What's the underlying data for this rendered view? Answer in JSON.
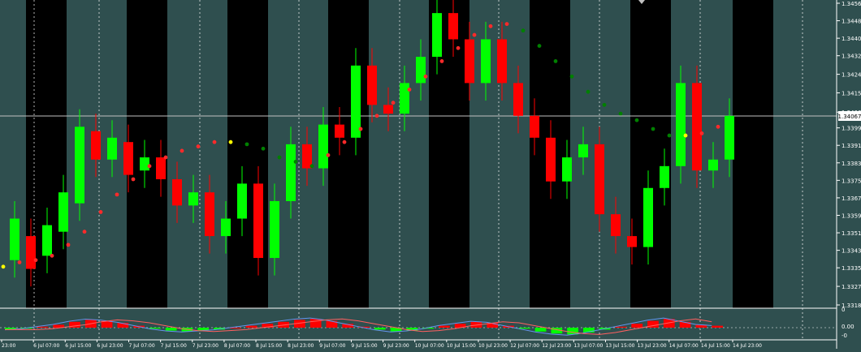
{
  "colors": {
    "background": "#2f4f4f",
    "session_band": "#000000",
    "bull_candle": "#00ff00",
    "bear_candle": "#ff0000",
    "ma_up": "#ff2a2a",
    "ma_flat": "#ffff00",
    "ma_down": "#008000",
    "axis_text": "#ffffff",
    "grid": "#ffffff"
  },
  "price_axis": {
    "labels": [
      "1.34565",
      "1.34485",
      "1.34405",
      "1.34325",
      "1.34240",
      "1.34155",
      "1.34067",
      "1.33995",
      "1.33915",
      "1.33835",
      "1.33755",
      "1.33675",
      "1.33595",
      "1.33515",
      "1.33435",
      "1.33355",
      "1.33270",
      "1.33185"
    ],
    "current_price": "1.34067"
  },
  "oscillator_axis": {
    "labels": [
      "0",
      "0.00",
      "-0"
    ]
  },
  "time_axis": {
    "labels": [
      "23:00",
      "6 Jul 07:00",
      "6 Jul 15:00",
      "6 Jul 23:00",
      "7 Jul 07:00",
      "7 Jul 15:00",
      "7 Jul 23:00",
      "8 Jul 07:00",
      "8 Jul 15:00",
      "8 Jul 23:00",
      "9 Jul 07:00",
      "9 Jul 15:00",
      "9 Jul 23:00",
      "10 Jul 07:00",
      "10 Jul 15:00",
      "10 Jul 23:00",
      "12 Jul 07:00",
      "12 Jul 23:00",
      "13 Jul 07:00",
      "13 Jul 15:00",
      "13 Jul 23:00",
      "14 Jul 07:00",
      "14 Jul 15:00",
      "14 Jul 23:00"
    ]
  },
  "chart_data": {
    "type": "candlestick",
    "y_range": [
      1.33185,
      1.34565
    ],
    "moving_average": [
      [
        1.3336,
        1.3338,
        1.3339,
        1.3341,
        1.3346,
        1.3352,
        1.3361,
        1.3369,
        1.3376,
        1.3382,
        1.3386,
        1.3389,
        1.3391,
        1.3393,
        1.3393,
        1.3392,
        1.339,
        1.3386,
        1.3384,
        1.3382,
        1.3387,
        1.3393,
        1.3399,
        1.3405,
        1.3411,
        1.3417,
        1.3423,
        1.343,
        1.3436,
        1.3442,
        1.3446,
        1.3447,
        1.3444,
        1.3437,
        1.343,
        1.3423,
        1.3416,
        1.341,
        1.3406,
        1.3403,
        1.3399,
        1.3396,
        1.3396,
        1.3397,
        1.34
      ]
    ],
    "candles": [
      [
        1.3339,
        1.3358
      ],
      [
        1.335,
        1.3335
      ],
      [
        1.3341,
        1.3355
      ],
      [
        1.3352,
        1.337
      ],
      [
        1.3365,
        1.34
      ],
      [
        1.3398,
        1.3385
      ],
      [
        1.3385,
        1.3395
      ],
      [
        1.3393,
        1.3378
      ],
      [
        1.338,
        1.3386
      ],
      [
        1.3386,
        1.3376
      ],
      [
        1.3376,
        1.3364
      ],
      [
        1.3364,
        1.337
      ],
      [
        1.337,
        1.335
      ],
      [
        1.335,
        1.3358
      ],
      [
        1.3358,
        1.3374
      ],
      [
        1.3374,
        1.334
      ],
      [
        1.334,
        1.3366
      ],
      [
        1.3366,
        1.3392
      ],
      [
        1.3392,
        1.3381
      ],
      [
        1.3381,
        1.3401
      ],
      [
        1.3401,
        1.3395
      ],
      [
        1.3395,
        1.3428
      ],
      [
        1.3428,
        1.341
      ],
      [
        1.341,
        1.3406
      ],
      [
        1.3406,
        1.342
      ],
      [
        1.342,
        1.3432
      ],
      [
        1.3432,
        1.3452
      ],
      [
        1.3452,
        1.344
      ],
      [
        1.344,
        1.342
      ],
      [
        1.342,
        1.344
      ],
      [
        1.344,
        1.342
      ],
      [
        1.342,
        1.3405
      ],
      [
        1.3405,
        1.3395
      ],
      [
        1.3395,
        1.3375
      ],
      [
        1.3375,
        1.3386
      ],
      [
        1.3386,
        1.3392
      ],
      [
        1.3392,
        1.336
      ],
      [
        1.336,
        1.335
      ],
      [
        1.335,
        1.3345
      ],
      [
        1.3345,
        1.3372
      ],
      [
        1.3372,
        1.3382
      ],
      [
        1.3382,
        1.342
      ],
      [
        1.342,
        1.338
      ],
      [
        1.338,
        1.3385
      ],
      [
        1.3385,
        1.3405
      ]
    ]
  },
  "oscillator": {
    "values": [
      -0.2,
      -0.1,
      0.1,
      0.3,
      0.6,
      0.8,
      0.7,
      0.5,
      0.2,
      -0.1,
      -0.3,
      -0.4,
      -0.3,
      -0.2,
      0.0,
      0.2,
      0.4,
      0.6,
      0.8,
      0.9,
      0.7,
      0.4,
      0.1,
      -0.2,
      -0.4,
      -0.3,
      -0.1,
      0.2,
      0.4,
      0.6,
      0.5,
      0.2,
      -0.1,
      -0.4,
      -0.6,
      -0.7,
      -0.5,
      -0.2,
      0.1,
      0.4,
      0.7,
      0.9,
      0.6,
      0.3,
      0.2
    ]
  }
}
